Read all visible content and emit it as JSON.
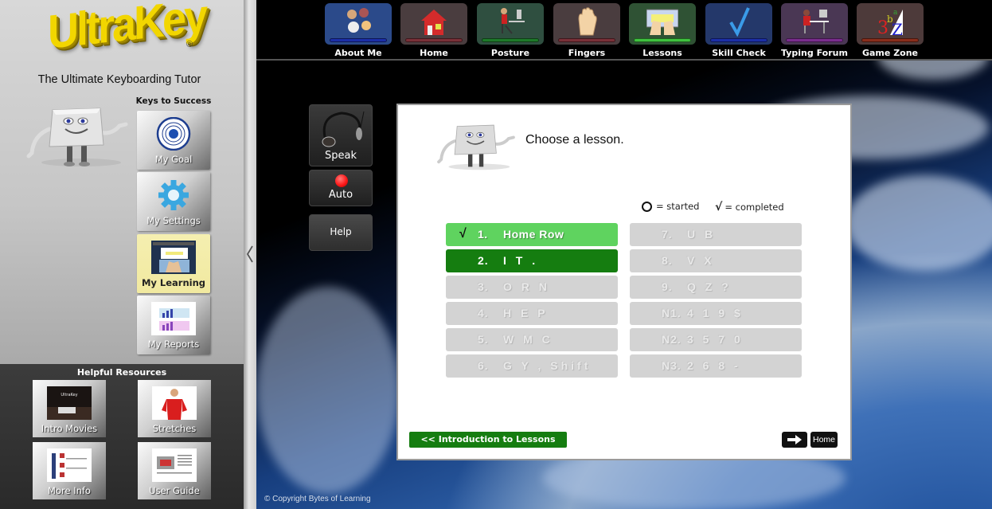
{
  "brand": {
    "logo_text": "UltraKey",
    "registered_mark": "®",
    "tagline": "The Ultimate Keyboarding Tutor"
  },
  "sidebar": {
    "keys_title": "Keys to Success",
    "keys": [
      {
        "label": "My Goal",
        "icon": "target-icon",
        "active": false
      },
      {
        "label": "My Settings",
        "icon": "gear-icon",
        "active": false
      },
      {
        "label": "My Learning",
        "icon": "learning-thumbnail",
        "active": true
      },
      {
        "label": "My Reports",
        "icon": "reports-thumbnail",
        "active": false
      }
    ],
    "resources_title": "Helpful Resources",
    "resources": [
      {
        "label": "Intro Movies",
        "icon": "movie-thumbnail"
      },
      {
        "label": "Stretches",
        "icon": "stretches-thumbnail"
      },
      {
        "label": "More Info",
        "icon": "info-thumbnail"
      },
      {
        "label": "User Guide",
        "icon": "guide-thumbnail"
      }
    ]
  },
  "topnav": [
    {
      "label": "About Me",
      "icon": "people-icon",
      "color": "#2b4a8a",
      "bar": "#1c2fa8"
    },
    {
      "label": "Home",
      "icon": "house-icon",
      "color": "#4a3d3f",
      "bar": "#7a3038"
    },
    {
      "label": "Posture",
      "icon": "posture-icon",
      "color": "#2f4f40",
      "bar": "#1e7a2a"
    },
    {
      "label": "Fingers",
      "icon": "hand-icon",
      "color": "#4a3d3f",
      "bar": "#7a3038"
    },
    {
      "label": "Lessons",
      "icon": "keyboard-hands-icon",
      "color": "#2f5234",
      "bar": "#3fc23f"
    },
    {
      "label": "Skill Check",
      "icon": "checkmark-icon",
      "color": "#24386a",
      "bar": "#1c2fa8"
    },
    {
      "label": "Typing Forum",
      "icon": "forum-icon",
      "color": "#4a3754",
      "bar": "#7a2d8e"
    },
    {
      "label": "Game Zone",
      "icon": "abc-icon",
      "color": "#4d3a3a",
      "bar": "#8a2e1c"
    }
  ],
  "controls": {
    "speak_label": "Speak",
    "auto_label": "Auto",
    "help_label": "Help",
    "auto_indicator_color": "#ff1a1a"
  },
  "panel": {
    "prompt": "Choose a lesson.",
    "legend_started": "= started",
    "legend_completed": "= completed",
    "check_symbol": "√",
    "lessons_left": [
      {
        "num": "1.",
        "keys": "Home Row",
        "status": "completed"
      },
      {
        "num": "2.",
        "keys": "I T .",
        "status": "current"
      },
      {
        "num": "3.",
        "keys": "O R N",
        "status": "locked"
      },
      {
        "num": "4.",
        "keys": "H E P",
        "status": "locked"
      },
      {
        "num": "5.",
        "keys": "W M C",
        "status": "locked"
      },
      {
        "num": "6.",
        "keys": "G Y , Shift",
        "status": "locked"
      }
    ],
    "lessons_right": [
      {
        "num": "7.",
        "keys": "U B",
        "status": "locked"
      },
      {
        "num": "8.",
        "keys": "V X",
        "status": "locked"
      },
      {
        "num": "9.",
        "keys": "Q Z ?",
        "status": "locked"
      },
      {
        "num": "N1.",
        "keys": "4 1 9 $",
        "status": "locked"
      },
      {
        "num": "N2.",
        "keys": "3 5 7 0",
        "status": "locked"
      },
      {
        "num": "N3.",
        "keys": "2 6 8 -",
        "status": "locked"
      }
    ],
    "intro_button": "<< Introduction to Lessons",
    "next_arrow": "→",
    "home_button": "Home"
  },
  "footer": {
    "copyright": "© Copyright Bytes of Learning"
  }
}
